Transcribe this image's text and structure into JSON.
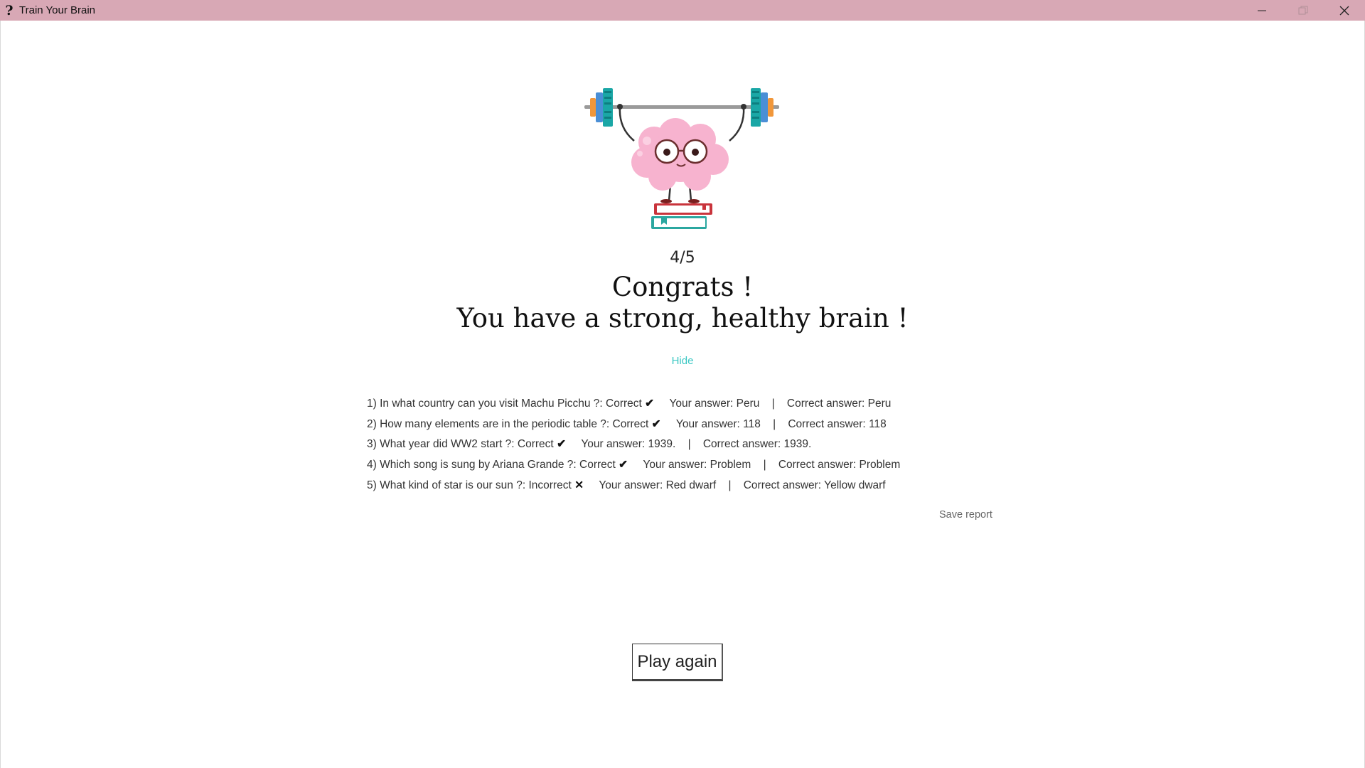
{
  "window": {
    "app_icon_glyph": "?",
    "title": "Train Your Brain",
    "controls": [
      "minimize",
      "maximize",
      "close"
    ]
  },
  "result": {
    "score": "4/5",
    "headline_1": "Congrats !",
    "headline_2": "You have a strong, healthy brain !",
    "hide_label": "Hide"
  },
  "report": [
    {
      "index": "1)",
      "question": "In what country can you visit Machu Picchu ?:",
      "status": "Correct",
      "mark": "✔",
      "your_answer_label": "Your answer:",
      "your_answer": "Peru",
      "correct_answer_label": "Correct answer:",
      "correct_answer": "Peru"
    },
    {
      "index": "2)",
      "question": "How many elements are in the periodic table ?:",
      "status": "Correct",
      "mark": "✔",
      "your_answer_label": "Your answer:",
      "your_answer": "118",
      "correct_answer_label": "Correct answer:",
      "correct_answer": "118"
    },
    {
      "index": "3)",
      "question": "What year did WW2 start ?:",
      "status": "Correct",
      "mark": "✔",
      "your_answer_label": "Your answer:",
      "your_answer": "1939.",
      "correct_answer_label": "Correct answer:",
      "correct_answer": "1939."
    },
    {
      "index": "4)",
      "question": "Which song is sung by Ariana Grande ?:",
      "status": "Correct",
      "mark": "✔",
      "your_answer_label": "Your answer:",
      "your_answer": "Problem",
      "correct_answer_label": "Correct answer:",
      "correct_answer": "Problem"
    },
    {
      "index": "5)",
      "question": "What kind of star is our sun ?:",
      "status": "Incorrect",
      "mark": "✕",
      "your_answer_label": "Your answer:",
      "your_answer": "Red dwarf",
      "correct_answer_label": "Correct answer:",
      "correct_answer": "Yellow dwarf"
    }
  ],
  "save_report_label": "Save report",
  "play_again_label": "Play again",
  "mascot": {
    "icon": "brain-lifting-barbell-icon",
    "colors": {
      "brain": "#f7b3cf",
      "plate_teal": "#1aa7a6",
      "plate_blue": "#4a8fd6",
      "plate_orange": "#f1973a",
      "bar": "#9a9a9a",
      "book_red": "#c9343c",
      "book_teal": "#2ba7a0"
    }
  },
  "colors": {
    "titlebar": "#d8a8b5",
    "link": "#3cc8c4"
  }
}
